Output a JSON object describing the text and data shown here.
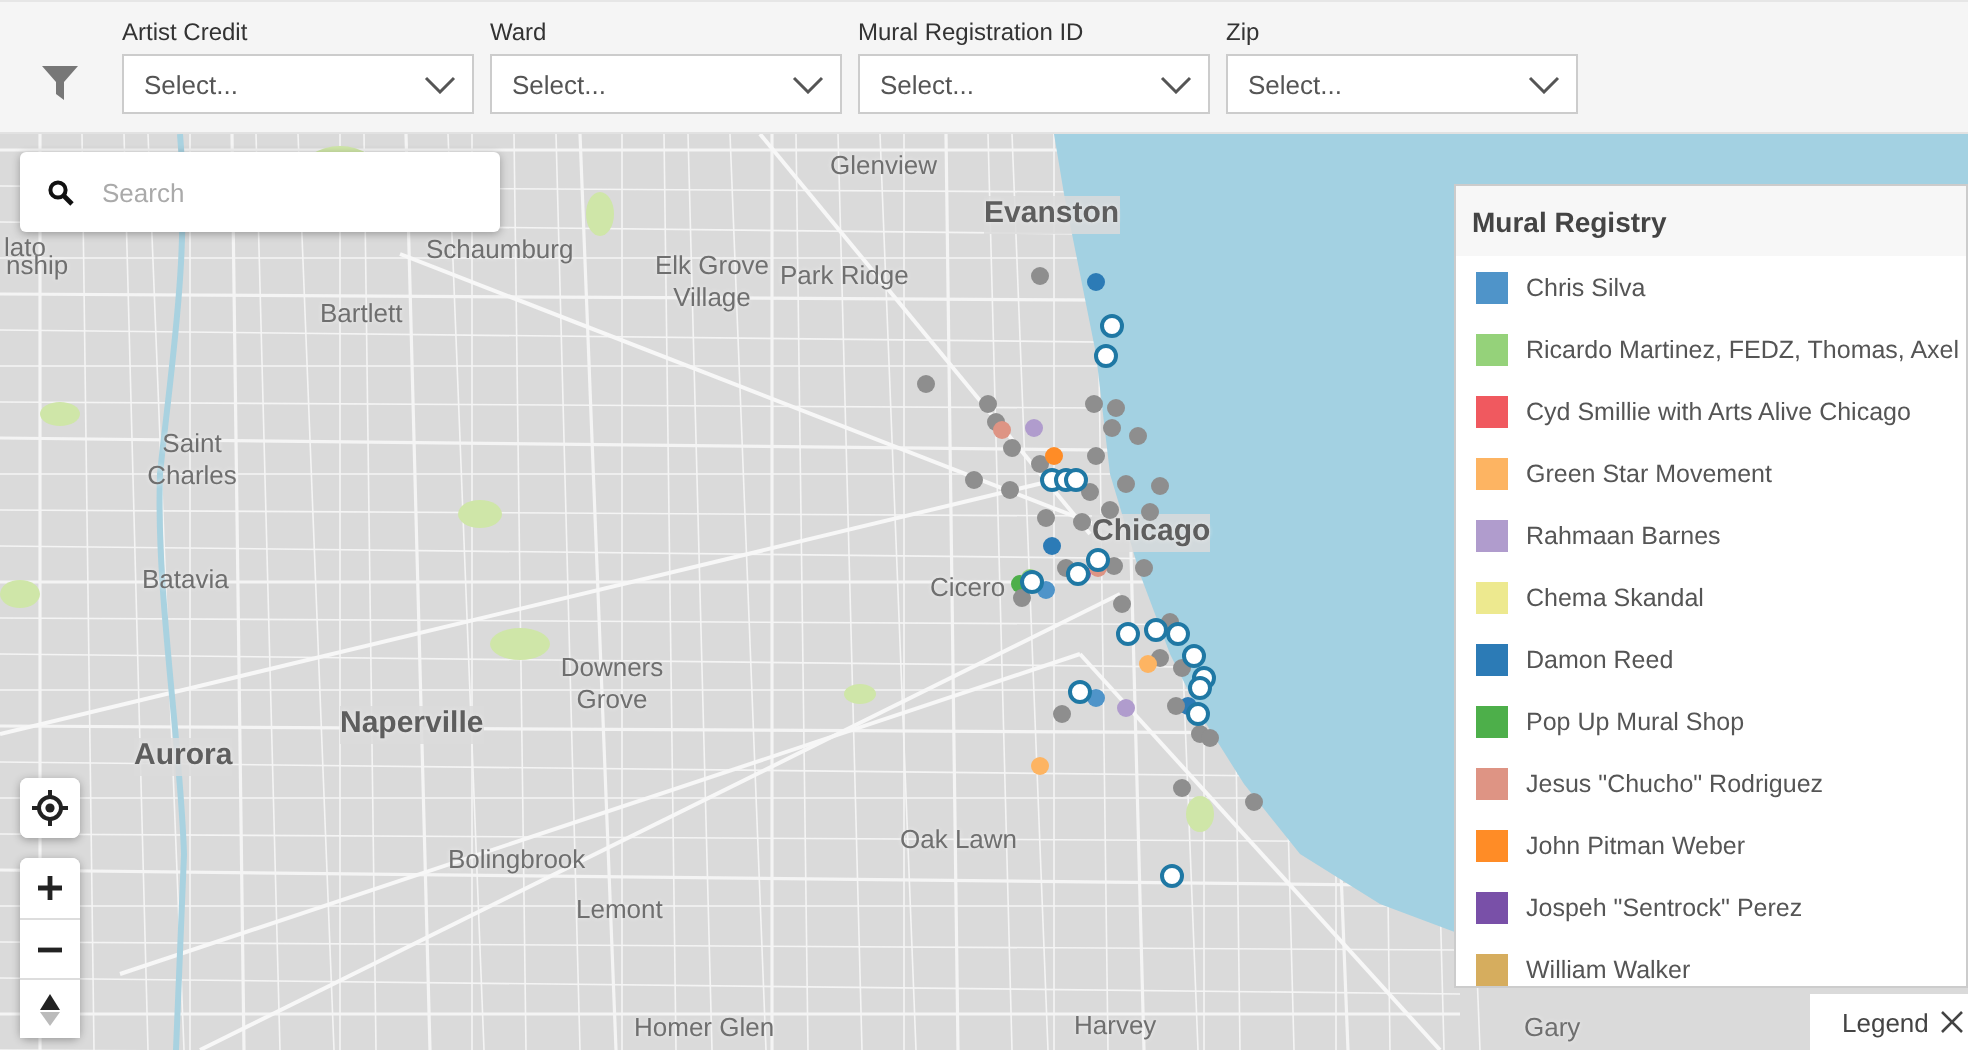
{
  "filters": [
    {
      "label": "Artist Credit",
      "placeholder": "Select..."
    },
    {
      "label": "Ward",
      "placeholder": "Select..."
    },
    {
      "label": "Mural Registration ID",
      "placeholder": "Select..."
    },
    {
      "label": "Zip",
      "placeholder": "Select..."
    }
  ],
  "search": {
    "placeholder": "Search"
  },
  "map_labels": [
    "lato",
    "nship",
    "Glenview",
    "Evanston",
    "Schaumburg",
    "Elk Grove Village",
    "Park Ridge",
    "Bartlett",
    "Saint Charles",
    "Chicago",
    "Batavia",
    "Cicero",
    "Downers Grove",
    "Naperville",
    "Aurora",
    "Bolingbrook",
    "Oak Lawn",
    "Lemont",
    "Homer Glen",
    "Harvey",
    "Gary"
  ],
  "legend": {
    "title": "Mural Registry",
    "items": [
      {
        "label": "Chris Silva",
        "color": "#4f94c9"
      },
      {
        "label": "Ricardo Martinez, FEDZ, Thomas, Axel",
        "color": "#95d27a"
      },
      {
        "label": "Cyd Smillie with Arts Alive Chicago",
        "color": "#f0595f"
      },
      {
        "label": "Green Star Movement",
        "color": "#fdb462"
      },
      {
        "label": "Rahmaan Barnes",
        "color": "#b09ccd"
      },
      {
        "label": "Chema Skandal",
        "color": "#ede98f"
      },
      {
        "label": "Damon Reed",
        "color": "#2c7bb6"
      },
      {
        "label": "Pop Up Mural Shop",
        "color": "#4daf4a"
      },
      {
        "label": "Jesus \"Chucho\" Rodriguez",
        "color": "#de9484"
      },
      {
        "label": "John Pitman Weber",
        "color": "#ff8c26"
      },
      {
        "label": "Jospeh \"Sentrock\" Perez",
        "color": "#7950a8"
      },
      {
        "label": "William Walker",
        "color": "#d6ad5e"
      }
    ]
  },
  "legend_toggle": {
    "label": "Legend"
  }
}
